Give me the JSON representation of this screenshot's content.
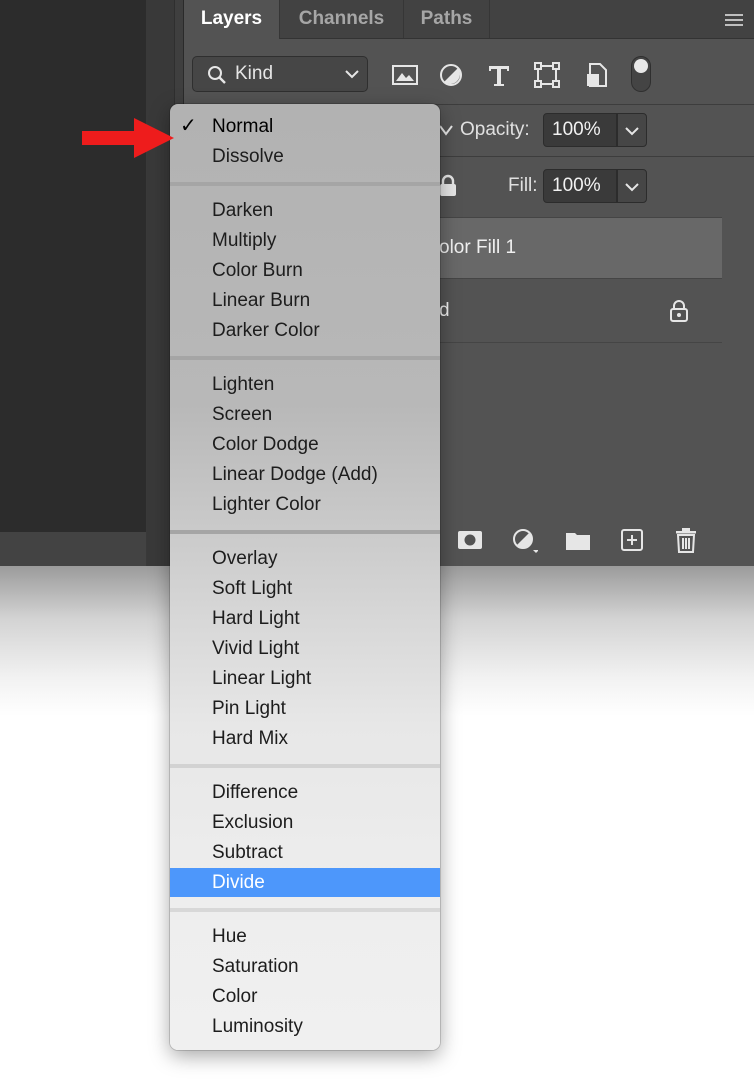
{
  "tabs": [
    "Layers",
    "Channels",
    "Paths"
  ],
  "filter": {
    "kind_label": "Kind",
    "icons": [
      "image-filter-icon",
      "adjustment-filter-icon",
      "type-filter-icon",
      "shape-filter-icon",
      "smart-object-filter-icon"
    ]
  },
  "opacity": {
    "label": "Opacity:",
    "value": "100%"
  },
  "fill": {
    "label": "Fill:",
    "value": "100%"
  },
  "layers": [
    {
      "name": "olor Fill 1"
    },
    {
      "name": "d"
    }
  ],
  "blend_menu": {
    "checkmark": "✓",
    "groups": [
      [
        "Normal",
        "Dissolve"
      ],
      [
        "Darken",
        "Multiply",
        "Color Burn",
        "Linear Burn",
        "Darker Color"
      ],
      [
        "Lighten",
        "Screen",
        "Color Dodge",
        "Linear Dodge (Add)",
        "Lighter Color"
      ],
      [
        "Overlay",
        "Soft Light",
        "Hard Light",
        "Vivid Light",
        "Linear Light",
        "Pin Light",
        "Hard Mix"
      ],
      [
        "Difference",
        "Exclusion",
        "Subtract",
        "Divide"
      ],
      [
        "Hue",
        "Saturation",
        "Color",
        "Luminosity"
      ]
    ],
    "checked_item": "Normal",
    "highlighted_item": "Divide"
  },
  "colors": {
    "highlight": "#4d97fb",
    "annotation_arrow": "#ee1c1c",
    "panel_bg": "#535353"
  }
}
